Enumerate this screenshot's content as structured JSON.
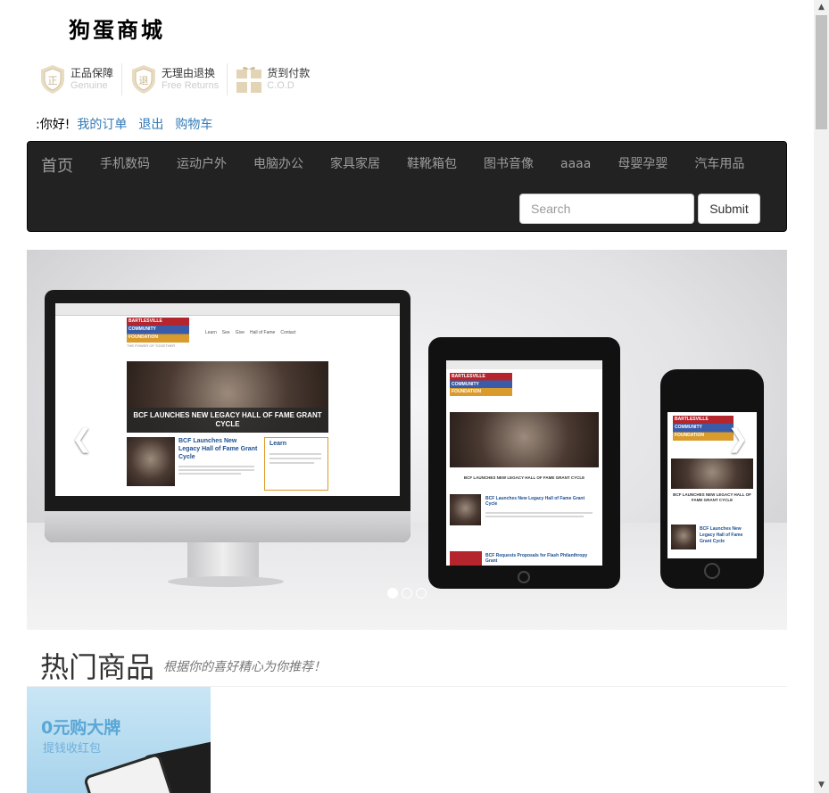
{
  "header": {
    "logo": "狗蛋商城",
    "badges": [
      {
        "icon": "genuine-shield-icon",
        "title": "正品保障",
        "subtitle": "Genuine",
        "glyph": "正"
      },
      {
        "icon": "returns-shield-icon",
        "title": "无理由退换",
        "subtitle": "Free Returns",
        "glyph": "退"
      },
      {
        "icon": "gift-box-icon",
        "title": "货到付款",
        "subtitle": "C.O.D",
        "glyph": ""
      }
    ],
    "greeting": ":你好!",
    "links": [
      "我的订单",
      "退出",
      "购物车"
    ]
  },
  "navbar": {
    "brand": "首页",
    "items": [
      "手机数码",
      "运动户外",
      "电脑办公",
      "家具家居",
      "鞋靴箱包",
      "图书音像",
      "aaaa",
      "母婴孕婴",
      "汽车用品"
    ],
    "search_placeholder": "Search",
    "submit_label": "Submit"
  },
  "carousel": {
    "slide_count": 3,
    "active_index": 0,
    "slide": {
      "logo_lines": [
        "BARTLESVILLE",
        "COMMUNITY",
        "FOUNDATION"
      ],
      "tagline": "THE POWER OF TOGETHER",
      "monitor_nav": [
        "Learn",
        "See",
        "Give",
        "Hall of Fame",
        "Contact"
      ],
      "headline": "BCF LAUNCHES NEW LEGACY HALL OF FAME GRANT CYCLE",
      "article_title": "BCF Launches New Legacy Hall of Fame Grant Cycle",
      "sidebar_title": "Learn",
      "tablet_headline": "BCF LAUNCHES NEW LEGACY HALL OF FAME GRANT CYCLE",
      "tablet_article": "BCF Launches New Legacy Hall of Fame Grant Cycle",
      "tablet_article2": "BCF Requests Proposals for Flash Philanthropy Grant",
      "phone_headline": "BCF LAUNCHES NEW LEGACY HALL OF FAME GRANT CYCLE",
      "phone_article": "BCF Launches New Legacy Hall of Fame Grant Cycle"
    }
  },
  "hot": {
    "title": "热门商品",
    "subtitle": "根据你的喜好精心为你推荐！",
    "banner": {
      "headline": "0元购大牌",
      "subline": "提钱收红包"
    }
  },
  "colors": {
    "navbar_bg": "#222222",
    "link": "#337ab7",
    "nav_text": "#9d9d9d"
  }
}
